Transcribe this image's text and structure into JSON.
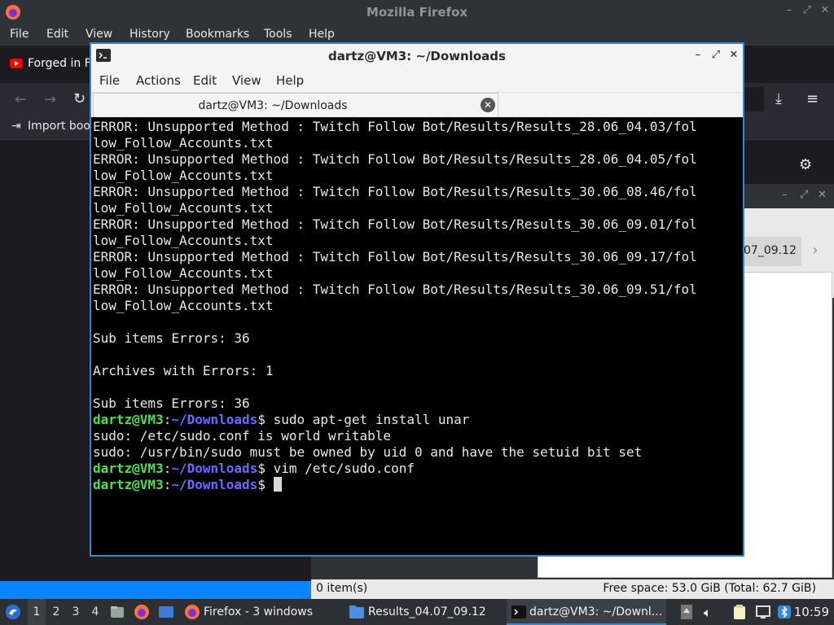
{
  "firefox": {
    "title": "Mozilla Firefox",
    "menu": [
      "File",
      "Edit",
      "View",
      "History",
      "Bookmarks",
      "Tools",
      "Help"
    ],
    "tab_label": "Forged in Fi",
    "bookmark_import": "Import bool"
  },
  "file_manager": {
    "breadcrumb_partial": "07_09.12",
    "status_items": "0 item(s)",
    "status_space": "Free space: 53.0 GiB (Total: 62.7 GiB)"
  },
  "terminal": {
    "title": "dartz@VM3: ~/Downloads",
    "menu": [
      "File",
      "Actions",
      "Edit",
      "View",
      "Help"
    ],
    "tab_label": "dartz@VM3: ~/Downloads",
    "lines": [
      "ERROR: Unsupported Method : Twitch Follow Bot/Results/Results_28.06_04.03/fol",
      "low_Follow_Accounts.txt",
      "ERROR: Unsupported Method : Twitch Follow Bot/Results/Results_28.06_04.05/fol",
      "low_Follow_Accounts.txt",
      "ERROR: Unsupported Method : Twitch Follow Bot/Results/Results_30.06_08.46/fol",
      "low_Follow_Accounts.txt",
      "ERROR: Unsupported Method : Twitch Follow Bot/Results/Results_30.06_09.01/fol",
      "low_Follow_Accounts.txt",
      "ERROR: Unsupported Method : Twitch Follow Bot/Results/Results_30.06_09.17/fol",
      "low_Follow_Accounts.txt",
      "ERROR: Unsupported Method : Twitch Follow Bot/Results/Results_30.06_09.51/fol",
      "low_Follow_Accounts.txt",
      "",
      "Sub items Errors: 36",
      "",
      "Archives with Errors: 1",
      "",
      "Sub items Errors: 36"
    ],
    "prompt_user": "dartz@VM3",
    "prompt_path": "~/Downloads",
    "prompt_sep": ":",
    "prompt_end": "$",
    "cmd1": " sudo apt-get install unar",
    "out1": "sudo: /etc/sudo.conf is world writable",
    "out2": "sudo: /usr/bin/sudo must be owned by uid 0 and have the setuid bit set",
    "cmd2": " vim /etc/sudo.conf",
    "cmd3": " "
  },
  "taskbar": {
    "workspaces": [
      "1",
      "2",
      "3",
      "4"
    ],
    "tasks": [
      "Firefox - 3 windows",
      "Results_04.07_09.12",
      "dartz@VM3: ~/Downl..."
    ],
    "clock": "10:59"
  },
  "colors": {
    "prompt_user": "#4ee04e",
    "prompt_path": "#6b6bff",
    "accent": "#3a86c8"
  }
}
